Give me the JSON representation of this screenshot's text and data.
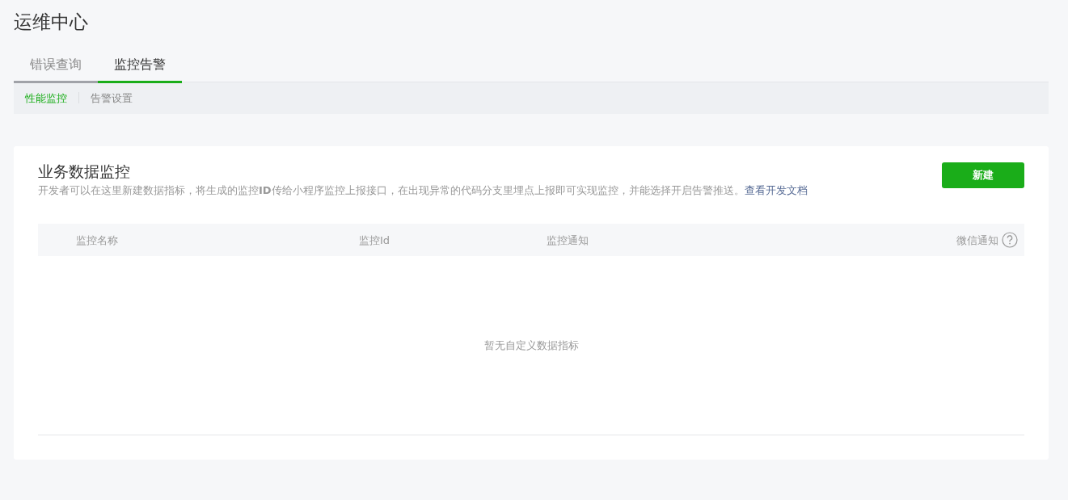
{
  "page_title": "运维中心",
  "tabs": [
    {
      "label": "错误查询",
      "selected": false
    },
    {
      "label": "监控告警",
      "selected": true
    }
  ],
  "sub_tabs": [
    {
      "label": "性能监控",
      "selected": true
    },
    {
      "label": "告警设置",
      "selected": false
    }
  ],
  "panel": {
    "title": "业务数据监控",
    "description": "开发者可以在这里新建数据指标，将生成的监控**ID**传给小程序监控上报接口，在出现异常的代码分支里埋点上报即可实现监控，并能选择开启告警推送。",
    "doc_link": "查看开发文档",
    "new_button": "新建",
    "table": {
      "columns": [
        {
          "label": "监控名称",
          "kind": "plain"
        },
        {
          "label": "监控Id",
          "kind": "plain"
        },
        {
          "label": "监控通知",
          "kind": "plain"
        },
        {
          "label": "微信通知",
          "kind": "help"
        }
      ],
      "empty_text": "暂无自定义数据指标"
    }
  }
}
